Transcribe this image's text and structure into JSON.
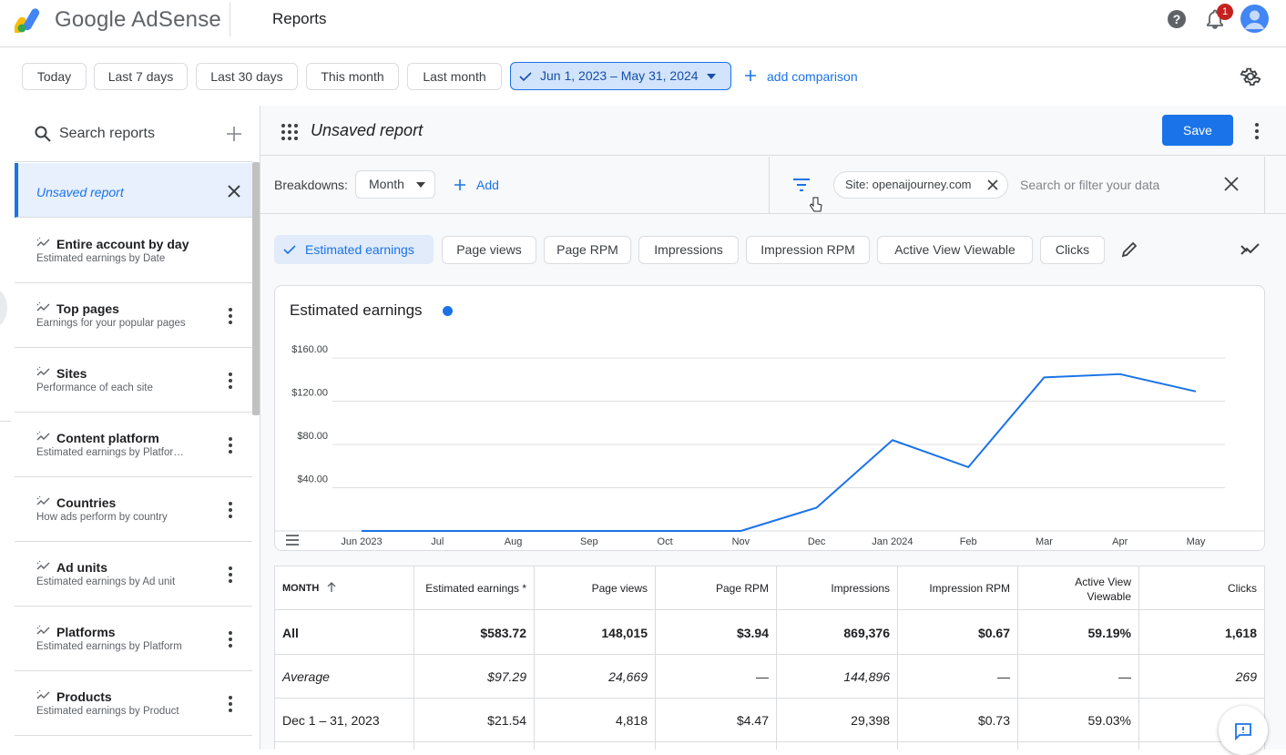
{
  "app": {
    "brand": "Google AdSense",
    "page_title": "Reports",
    "notification_count": "1"
  },
  "date_bar": {
    "chips": [
      "Today",
      "Last 7 days",
      "Last 30 days",
      "This month",
      "Last month"
    ],
    "selected_range": "Jun 1, 2023 – May 31, 2024",
    "add_comparison": "add comparison"
  },
  "sidebar": {
    "search_placeholder": "Search reports",
    "active_item": "Unsaved report",
    "items": [
      {
        "title": "Entire account by day",
        "subtitle": "Estimated earnings by Date"
      },
      {
        "title": "Top pages",
        "subtitle": "Earnings for your popular pages"
      },
      {
        "title": "Sites",
        "subtitle": "Performance of each site"
      },
      {
        "title": "Content platform",
        "subtitle": "Estimated earnings by Platfor…"
      },
      {
        "title": "Countries",
        "subtitle": "How ads perform by country"
      },
      {
        "title": "Ad units",
        "subtitle": "Estimated earnings by Ad unit"
      },
      {
        "title": "Platforms",
        "subtitle": "Estimated earnings by Platform"
      },
      {
        "title": "Products",
        "subtitle": "Estimated earnings by Product"
      }
    ]
  },
  "report": {
    "name": "Unsaved report",
    "save_label": "Save",
    "breakdowns_label": "Breakdowns:",
    "breakdown_value": "Month",
    "add_label": "Add",
    "filter_chip": "Site: openaijourney.com",
    "filter_placeholder": "Search or filter your data"
  },
  "metrics": {
    "selected": "Estimated earnings",
    "others": [
      "Page views",
      "Page RPM",
      "Impressions",
      "Impression RPM",
      "Active View Viewable",
      "Clicks"
    ]
  },
  "chart_data": {
    "type": "line",
    "title": "Estimated earnings",
    "categories": [
      "Jun 2023",
      "Jul",
      "Aug",
      "Sep",
      "Oct",
      "Nov",
      "Dec",
      "Jan 2024",
      "Feb",
      "Mar",
      "Apr",
      "May"
    ],
    "series": [
      {
        "values": [
          0,
          0,
          0,
          0,
          0,
          0,
          21.54,
          84,
          59,
          142,
          145,
          129
        ],
        "color": "#1a73e8"
      }
    ],
    "y_ticks": [
      "$40.00",
      "$80.00",
      "$120.00",
      "$160.00"
    ],
    "ylim": [
      0,
      160
    ],
    "grid": true
  },
  "table": {
    "headers": [
      "MONTH",
      "Estimated earnings *",
      "Page views",
      "Page RPM",
      "Impressions",
      "Impression RPM",
      "Active View Viewable",
      "Clicks"
    ],
    "rows": [
      {
        "label": "All",
        "values": [
          "$583.72",
          "148,015",
          "$3.94",
          "869,376",
          "$0.67",
          "59.19%",
          "1,618"
        ]
      },
      {
        "label": "Average",
        "values": [
          "$97.29",
          "24,669",
          "—",
          "144,896",
          "—",
          "—",
          "269"
        ]
      },
      {
        "label": "Dec 1 – 31, 2023",
        "values": [
          "$21.54",
          "4,818",
          "$4.47",
          "29,398",
          "$0.73",
          "59.03%",
          ""
        ]
      }
    ]
  }
}
